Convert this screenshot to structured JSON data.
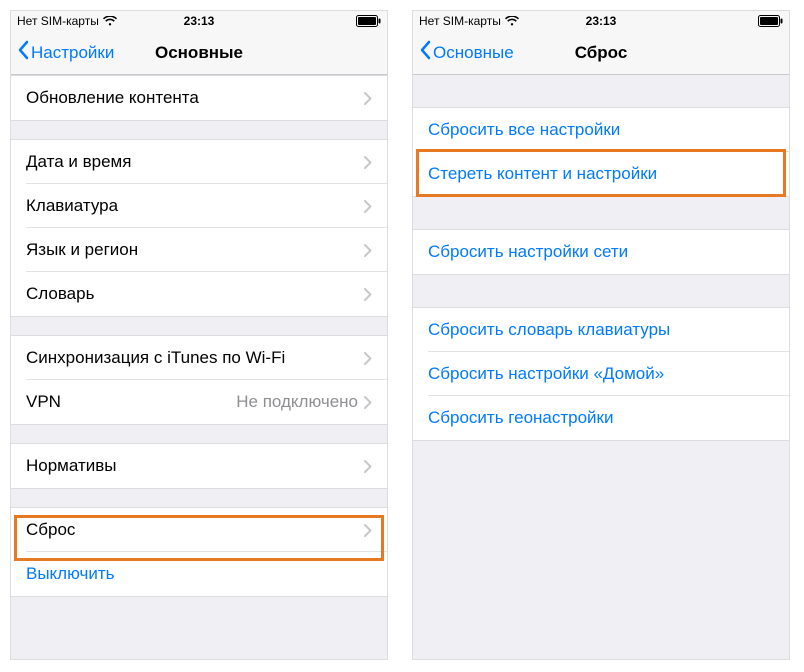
{
  "statusbar": {
    "carrier": "Нет SIM-карты",
    "time": "23:13"
  },
  "left_screen": {
    "back_label": "Настройки",
    "title": "Основные",
    "groups": [
      {
        "rows": [
          {
            "label": "Обновление контента",
            "chevron": true
          }
        ]
      },
      {
        "rows": [
          {
            "label": "Дата и время",
            "chevron": true
          },
          {
            "label": "Клавиатура",
            "chevron": true
          },
          {
            "label": "Язык и регион",
            "chevron": true
          },
          {
            "label": "Словарь",
            "chevron": true
          }
        ]
      },
      {
        "rows": [
          {
            "label": "Синхронизация с iTunes по Wi-Fi",
            "chevron": true
          },
          {
            "label": "VPN",
            "detail": "Не подключено",
            "chevron": true
          }
        ]
      },
      {
        "rows": [
          {
            "label": "Нормативы",
            "chevron": true
          }
        ]
      },
      {
        "rows": [
          {
            "label": "Сброс",
            "chevron": true
          },
          {
            "label": "Выключить",
            "blue": true
          }
        ]
      }
    ]
  },
  "right_screen": {
    "back_label": "Основные",
    "title": "Сброс",
    "groups": [
      {
        "rows": [
          {
            "label": "Сбросить все настройки",
            "blue": true
          },
          {
            "label": "Стереть контент и настройки",
            "blue": true
          }
        ]
      },
      {
        "rows": [
          {
            "label": "Сбросить настройки сети",
            "blue": true
          }
        ]
      },
      {
        "rows": [
          {
            "label": "Сбросить словарь клавиатуры",
            "blue": true
          },
          {
            "label": "Сбросить настройки «Домой»",
            "blue": true
          },
          {
            "label": "Сбросить геонастройки",
            "blue": true
          }
        ]
      }
    ]
  },
  "highlight_color": "#e67a22"
}
